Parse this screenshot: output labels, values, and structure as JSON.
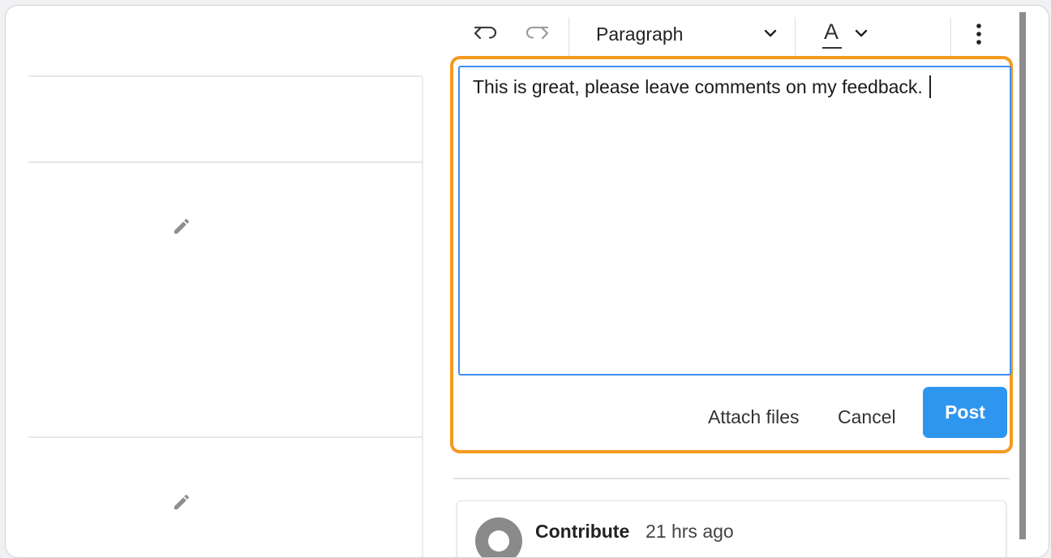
{
  "toolbar": {
    "undo_icon": "undo-icon",
    "redo_icon": "redo-icon",
    "paragraph_label": "Paragraph",
    "font_color_label": "A",
    "more_icon": "more-vertical-icon"
  },
  "editor": {
    "value": "This is great, please leave comments on my feedback."
  },
  "actions": {
    "attach_label": "Attach files",
    "cancel_label": "Cancel",
    "post_label": "Post"
  },
  "comment": {
    "author": "Contribute",
    "time": "21 hrs ago"
  },
  "colors": {
    "highlight": "#f39a1e",
    "post_button": "#2f96ef",
    "editor_border": "#3f8ef0"
  }
}
